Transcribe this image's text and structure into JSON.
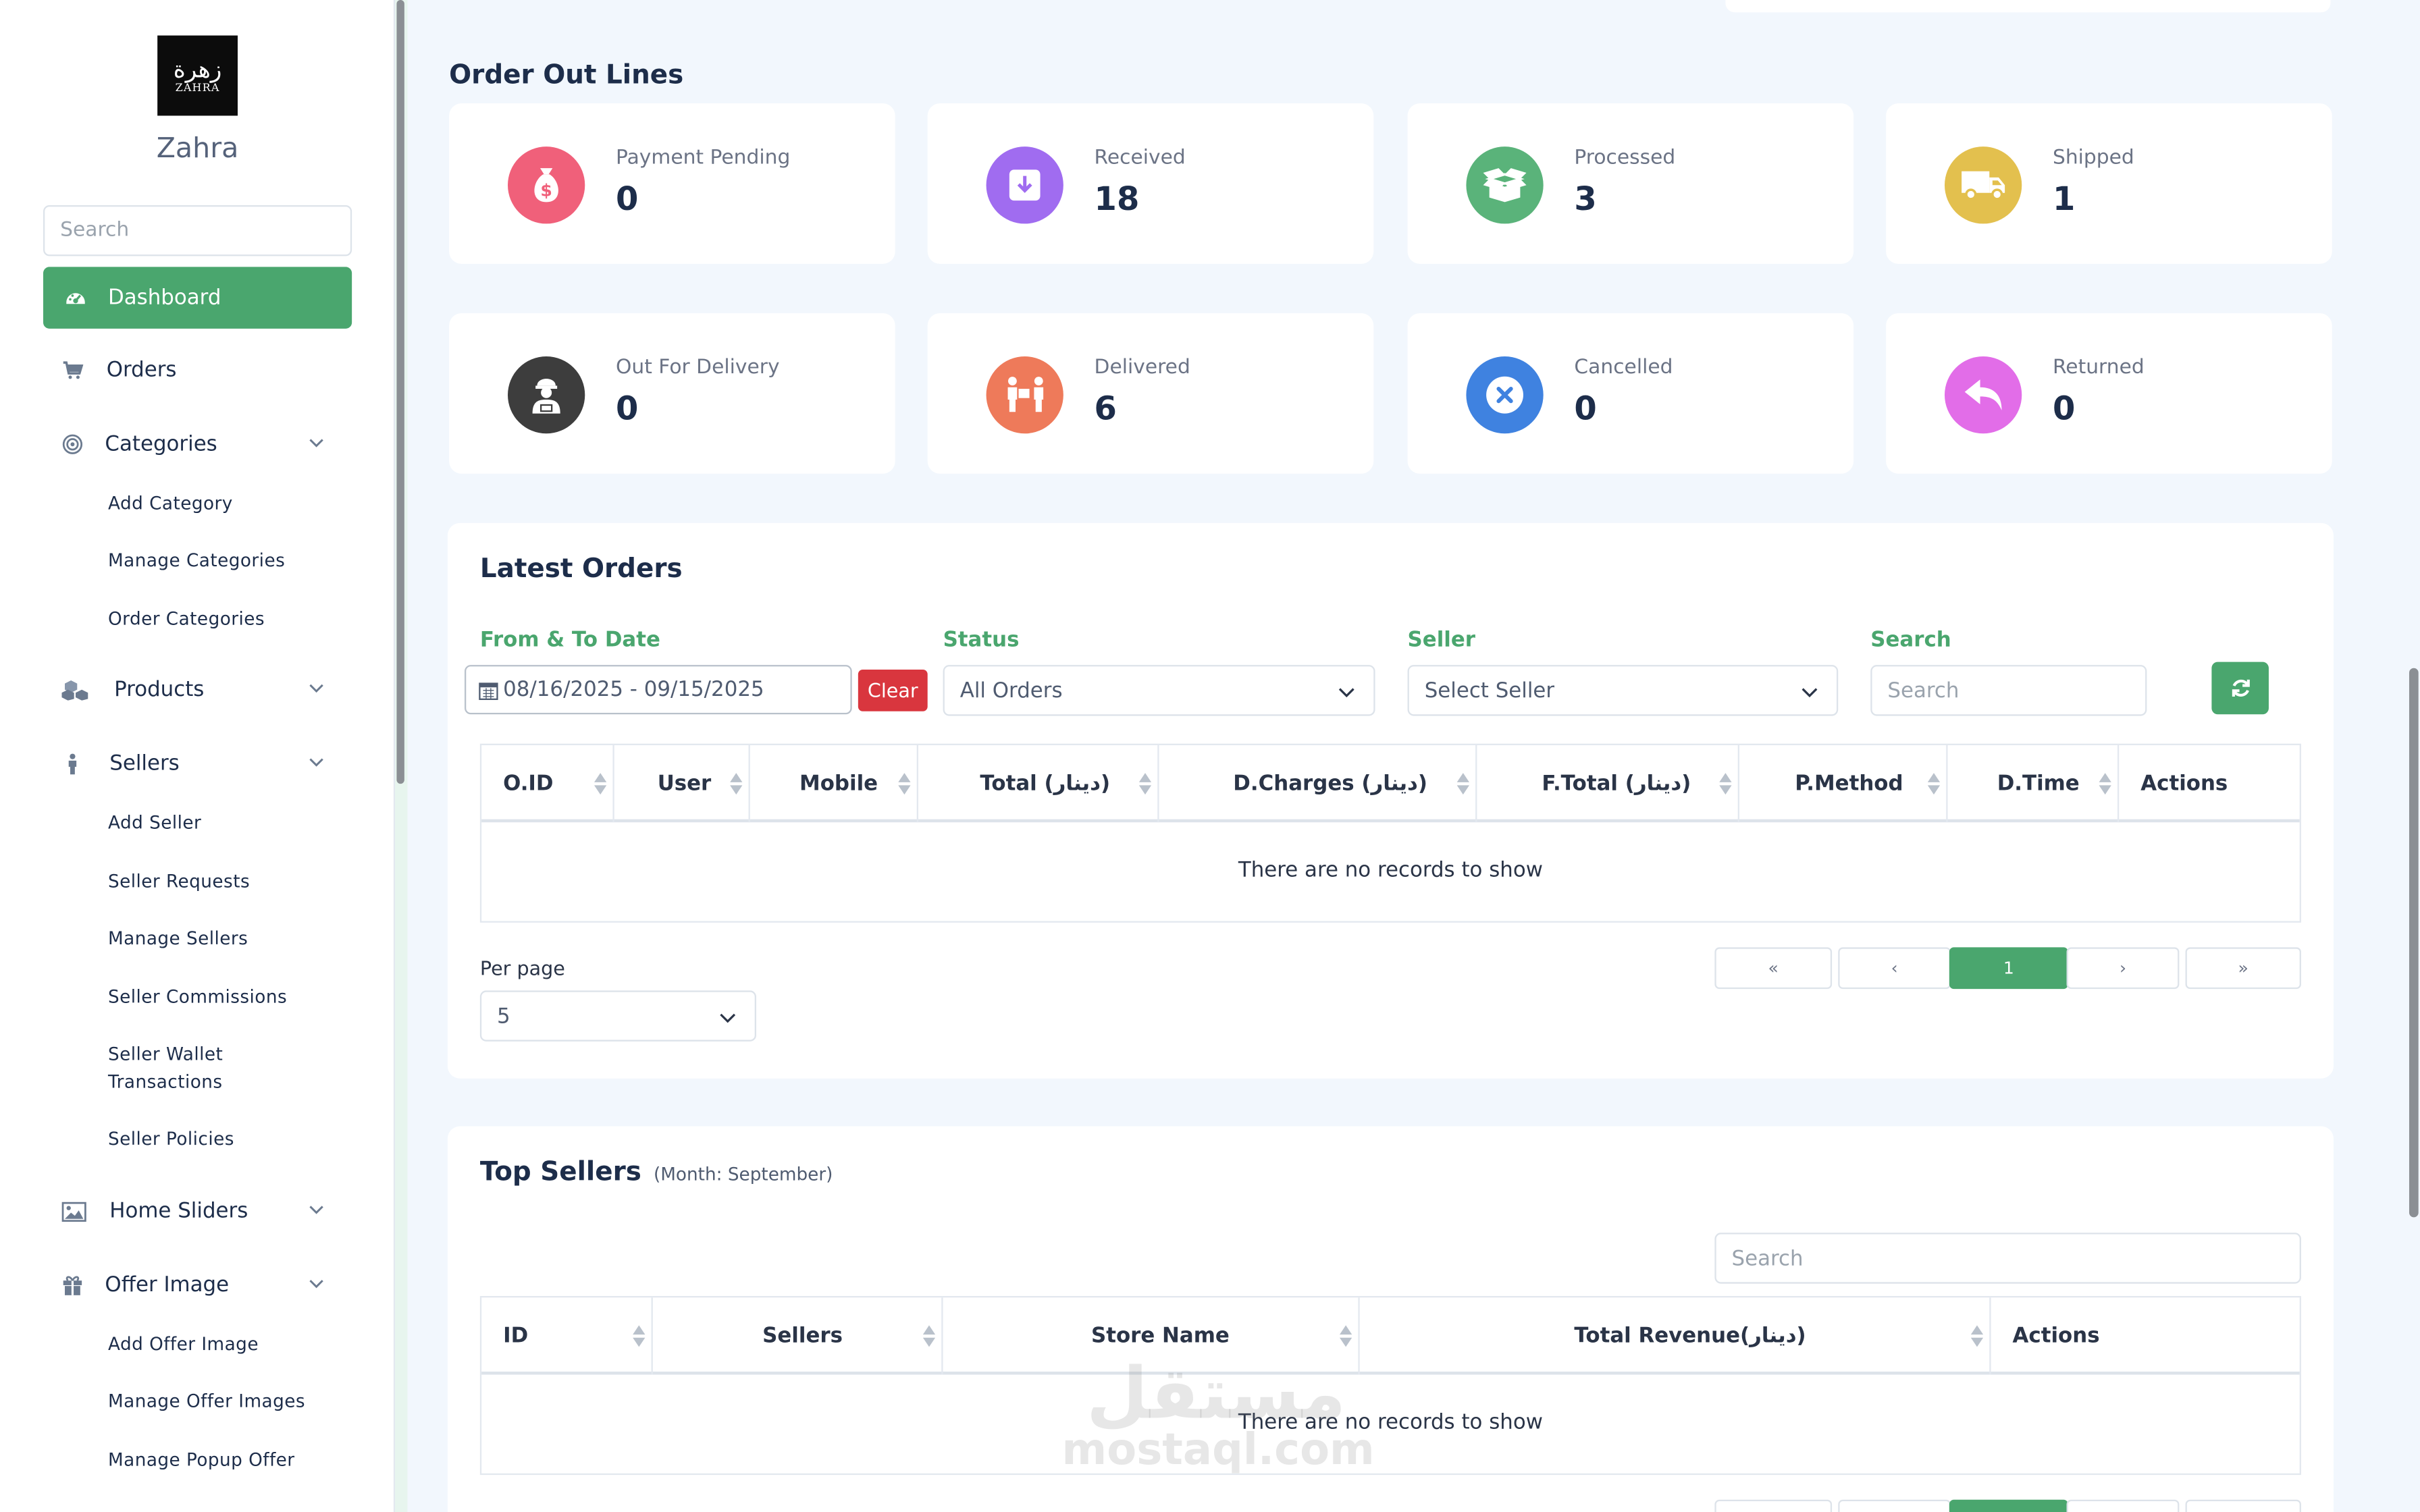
{
  "sidebar": {
    "logo_ar": "زهرة",
    "logo_en": "ZAHRA",
    "brand": "Zahra",
    "search_placeholder": "Search",
    "active": {
      "label": "Dashboard",
      "icon": "dashboard-icon"
    },
    "items": [
      {
        "label": "Orders",
        "icon": "cart-icon"
      },
      {
        "label": "Categories",
        "icon": "target-icon",
        "subs": [
          "Add Category",
          "Manage Categories",
          "Order Categories"
        ]
      },
      {
        "label": "Products",
        "icon": "cubes-icon"
      },
      {
        "label": "Sellers",
        "icon": "user-icon",
        "subs": [
          "Add Seller",
          "Seller Requests",
          "Manage Sellers",
          "Seller Commissions",
          "Seller Wallet Transactions",
          "Seller Policies"
        ]
      },
      {
        "label": "Home Sliders",
        "icon": "image-icon"
      },
      {
        "label": "Offer Image",
        "icon": "gift-icon",
        "subs": [
          "Add Offer Image",
          "Manage Offer Images",
          "Manage Popup Offer"
        ]
      }
    ]
  },
  "order_out_lines": {
    "title": "Order Out Lines",
    "cards": [
      {
        "label": "Payment Pending",
        "value": "0",
        "color": "#f0607a",
        "icon": "money-bag-icon"
      },
      {
        "label": "Received",
        "value": "18",
        "color": "#a06cf0",
        "icon": "download-icon"
      },
      {
        "label": "Processed",
        "value": "3",
        "color": "#5ab37a",
        "icon": "open-box-icon"
      },
      {
        "label": "Shipped",
        "value": "1",
        "color": "#e3c04e",
        "icon": "truck-icon"
      },
      {
        "label": "Out For Delivery",
        "value": "0",
        "color": "#3d3d3d",
        "icon": "courier-icon"
      },
      {
        "label": "Delivered",
        "value": "6",
        "color": "#ee7a5a",
        "icon": "delivery-person-icon"
      },
      {
        "label": "Cancelled",
        "value": "0",
        "color": "#3f82e0",
        "icon": "cancel-icon"
      },
      {
        "label": "Returned",
        "value": "0",
        "color": "#e26de8",
        "icon": "reply-icon"
      }
    ]
  },
  "latest_orders": {
    "title": "Latest Orders",
    "filters": {
      "date_label": "From & To Date",
      "date_value": "08/16/2025 - 09/15/2025",
      "clear_label": "Clear",
      "status_label": "Status",
      "status_value": "All Orders",
      "seller_label": "Seller",
      "seller_value": "Select Seller",
      "search_label": "Search",
      "search_placeholder": "Search"
    },
    "columns": [
      "O.ID",
      "User",
      "Mobile",
      "Total (دينار)",
      "D.Charges (دينار)",
      "F.Total (دينار)",
      "P.Method",
      "D.Time",
      "Actions"
    ],
    "empty_text": "There are no records to show",
    "per_page_label": "Per page",
    "per_page_value": "5",
    "pager": {
      "first": "«",
      "prev": "‹",
      "current": "1",
      "next": "›",
      "last": "»"
    }
  },
  "top_sellers": {
    "title": "Top Sellers",
    "subtitle": "(Month: September)",
    "search_placeholder": "Search",
    "columns": [
      "ID",
      "Sellers",
      "Store Name",
      "Total Revenue(دينار)",
      "Actions"
    ],
    "empty_text": "There are no records to show"
  },
  "watermark": {
    "ar": "مستقل",
    "en": "mostaql.com"
  }
}
